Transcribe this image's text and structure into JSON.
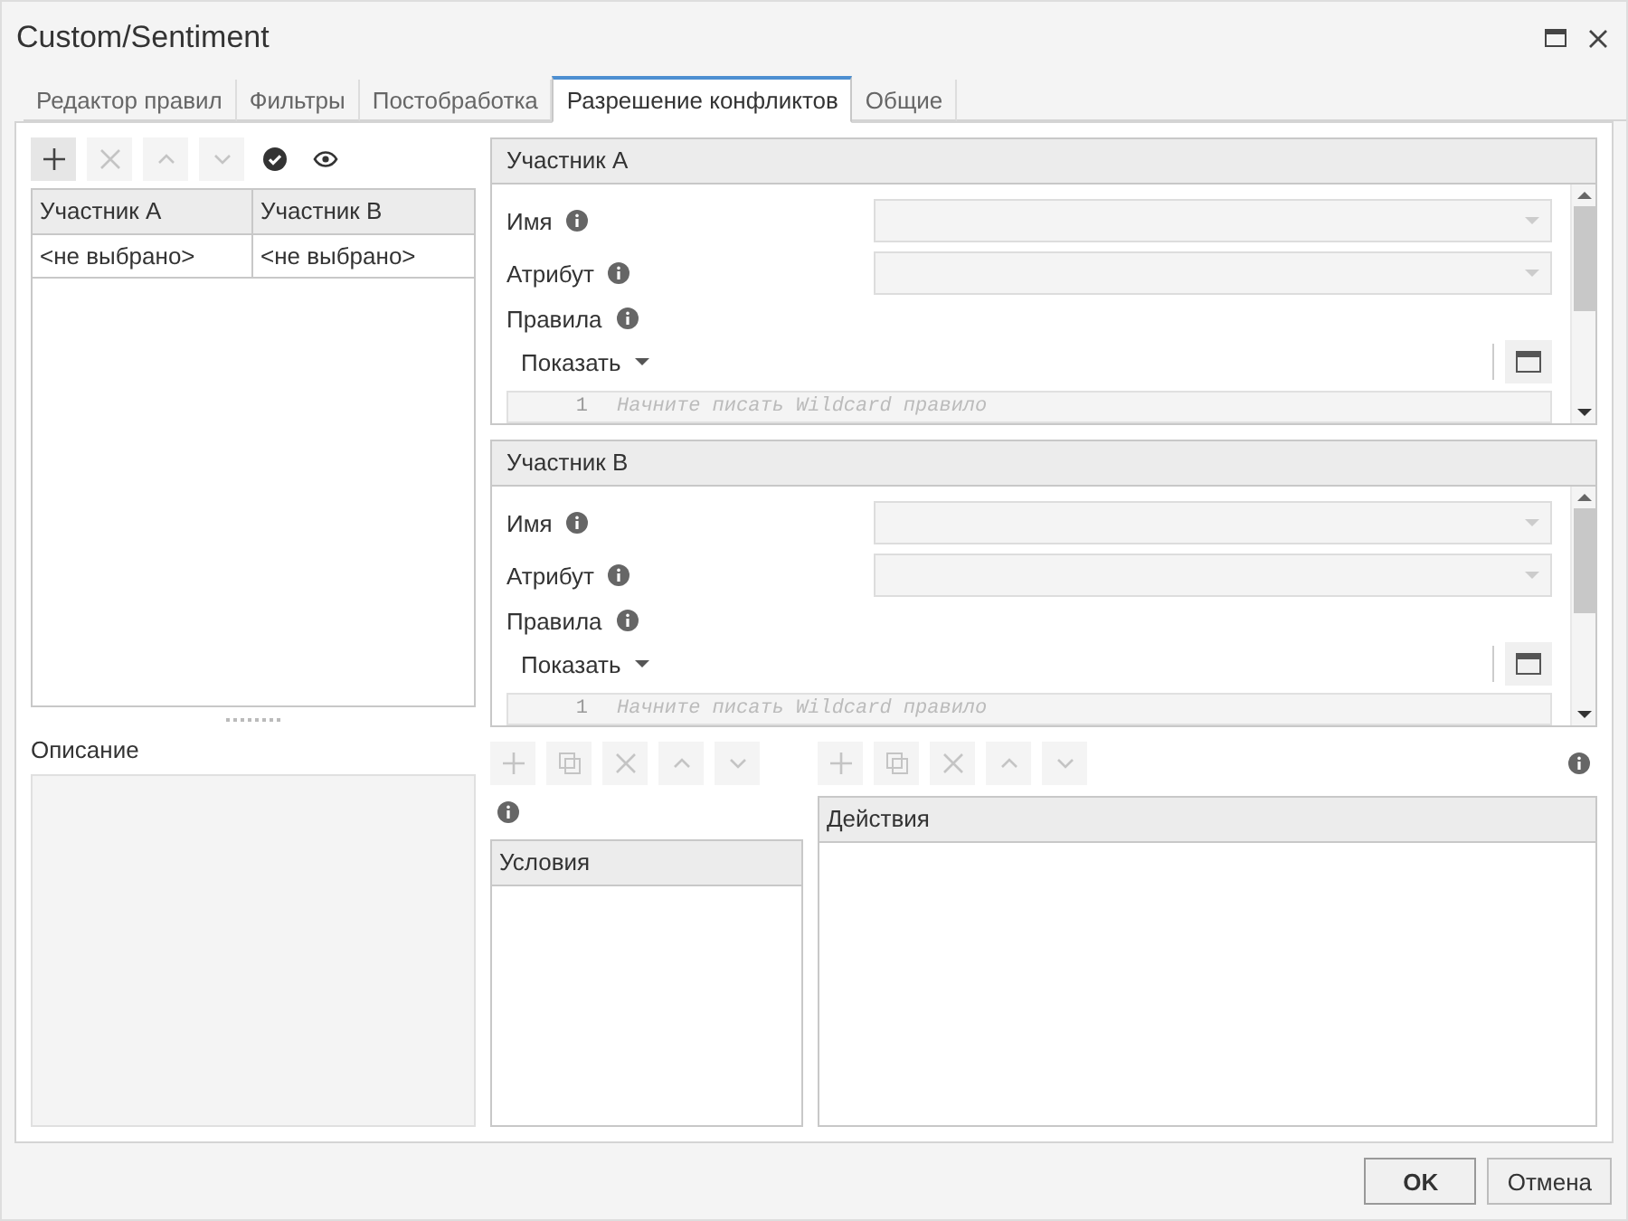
{
  "window": {
    "title": "Custom/Sentiment"
  },
  "tabs": [
    {
      "label": "Редактор правил",
      "selected": false
    },
    {
      "label": "Фильтры",
      "selected": false
    },
    {
      "label": "Постобработка",
      "selected": false
    },
    {
      "label": "Разрешение конфликтов",
      "selected": true
    },
    {
      "label": "Общие",
      "selected": false
    }
  ],
  "pair_toolbar": [
    {
      "kind": "add",
      "disabled": false
    },
    {
      "kind": "delete",
      "disabled": true
    },
    {
      "kind": "up",
      "disabled": true
    },
    {
      "kind": "down",
      "disabled": true
    },
    {
      "kind": "check",
      "disabled": false
    },
    {
      "kind": "eye",
      "disabled": false
    }
  ],
  "pairs_table": {
    "columns": [
      "Участник A",
      "Участник B"
    ],
    "rows": [
      [
        "<не выбрано>",
        "<не выбрано>"
      ]
    ]
  },
  "description": {
    "label": "Описание"
  },
  "participants": [
    {
      "title": "Участник A",
      "fields": [
        {
          "label": "Имя",
          "disabled": true
        },
        {
          "label": "Атрибут",
          "disabled": true
        }
      ],
      "rules_label": "Правила",
      "show_button": "Показать",
      "editor": {
        "line_number": "1",
        "placeholder": "Начните писать Wildcard правило"
      }
    },
    {
      "title": "Участник B",
      "fields": [
        {
          "label": "Имя",
          "disabled": true
        },
        {
          "label": "Атрибут",
          "disabled": true
        }
      ],
      "rules_label": "Правила",
      "show_button": "Показать",
      "editor": {
        "line_number": "1",
        "placeholder": "Начните писать Wildcard правило"
      }
    }
  ],
  "conditions": {
    "toolbar": [
      {
        "kind": "add",
        "disabled": true
      },
      {
        "kind": "copy",
        "disabled": true
      },
      {
        "kind": "delete",
        "disabled": true
      },
      {
        "kind": "up",
        "disabled": true
      },
      {
        "kind": "down",
        "disabled": true
      }
    ],
    "header": "Условия"
  },
  "actions": {
    "toolbar": [
      {
        "kind": "add",
        "disabled": true
      },
      {
        "kind": "copy",
        "disabled": true
      },
      {
        "kind": "delete",
        "disabled": true
      },
      {
        "kind": "up",
        "disabled": true
      },
      {
        "kind": "down",
        "disabled": true
      }
    ],
    "header": "Действия"
  },
  "buttons": [
    {
      "label": "OK",
      "default": true
    },
    {
      "label": "Отмена",
      "default": false
    }
  ]
}
